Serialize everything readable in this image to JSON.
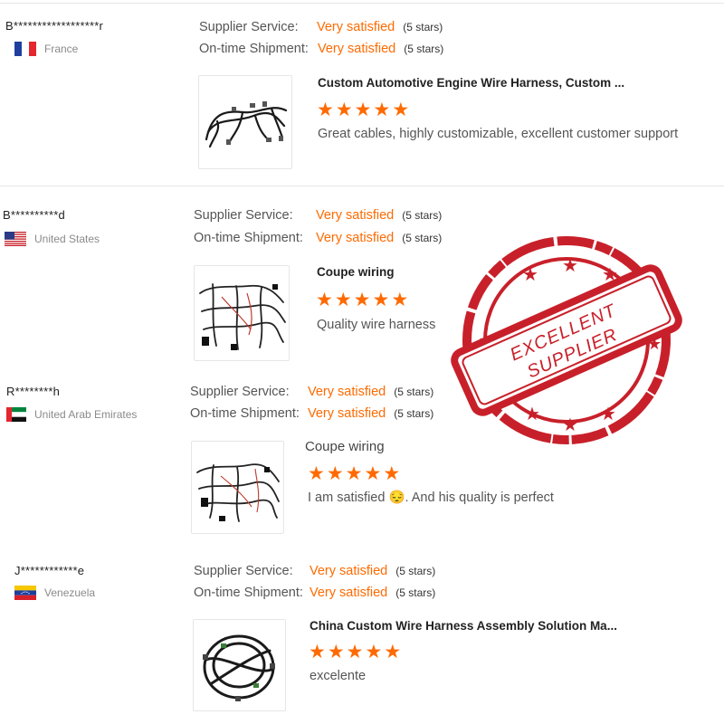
{
  "reviews": [
    {
      "buyer": "B******************r",
      "country": "France",
      "supplier_service_label": "Supplier Service:",
      "supplier_service_value": "Very satisfied",
      "supplier_service_stars": "(5 stars)",
      "shipment_label": "On-time Shipment:",
      "shipment_value": "Very satisfied",
      "shipment_stars": "(5 stars)",
      "product_title": "Custom Automotive Engine Wire Harness, Custom ...",
      "rating": 5,
      "comment": "Great cables, highly customizable, excellent customer support"
    },
    {
      "buyer": "B**********d",
      "country": "United States",
      "supplier_service_label": "Supplier Service:",
      "supplier_service_value": "Very satisfied",
      "supplier_service_stars": "(5 stars)",
      "shipment_label": "On-time Shipment:",
      "shipment_value": "Very satisfied",
      "shipment_stars": "(5 stars)",
      "product_title": "Coupe wiring",
      "rating": 5,
      "comment": "Quality wire harness"
    },
    {
      "buyer": "R********h",
      "country": "United Arab Emirates",
      "supplier_service_label": "Supplier Service:",
      "supplier_service_value": "Very satisfied",
      "supplier_service_stars": "(5 stars)",
      "shipment_label": "On-time Shipment:",
      "shipment_value": "Very satisfied",
      "shipment_stars": "(5 stars)",
      "product_title": "Coupe wiring",
      "rating": 5,
      "comment": "I am satisfied 😔. And his quality is perfect"
    },
    {
      "buyer": "J************e",
      "country": "Venezuela",
      "supplier_service_label": "Supplier Service:",
      "supplier_service_value": "Very satisfied",
      "supplier_service_stars": "(5 stars)",
      "shipment_label": "On-time Shipment:",
      "shipment_value": "Very satisfied",
      "shipment_stars": "(5 stars)",
      "product_title": "China Custom Wire Harness Assembly Solution Ma...",
      "rating": 5,
      "comment": "excelente"
    }
  ],
  "stamp": {
    "line1": "EXCELLENT",
    "line2": "SUPPLIER"
  },
  "colors": {
    "accent": "#ff6a00",
    "stamp": "#c8202a"
  }
}
